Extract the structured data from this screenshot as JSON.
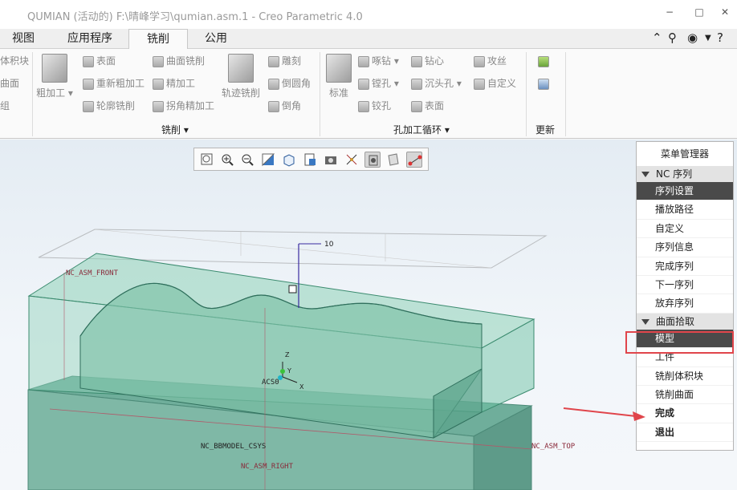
{
  "window": {
    "title": "QUMIAN (活动的) F:\\晴峰学习\\qumian.asm.1 - Creo Parametric 4.0",
    "minimize": "−",
    "maximize": "□",
    "close": "✕"
  },
  "tabs": [
    {
      "label": "视图"
    },
    {
      "label": "应用程序"
    },
    {
      "label": "铣削"
    },
    {
      "label": "公用"
    }
  ],
  "ribbon": {
    "partial_items": [
      "体积块",
      "曲面",
      "组"
    ],
    "milling": {
      "group_label": "铣削 ▾",
      "rough_label": "粗加工 ▾",
      "col1": [
        "表面",
        "重新粗加工",
        "轮廓铣削"
      ],
      "col2": [
        "曲面铣削",
        "精加工",
        "拐角精加工"
      ],
      "trajectory_label": "轨迹铣削",
      "col3": [
        "雕刻",
        "倒圆角",
        "倒角"
      ]
    },
    "hole": {
      "group_label": "孔加工循环 ▾",
      "standard_label": "标准",
      "col1": [
        "啄钻 ▾",
        "镗孔 ▾",
        "铰孔"
      ],
      "col2": [
        "钻心",
        "沉头孔 ▾",
        "表面"
      ],
      "col3": [
        "攻丝",
        "自定义"
      ]
    },
    "update": {
      "group_label": "更新"
    }
  },
  "model_labels": {
    "front": "NC_ASM_FRONT",
    "top": "NC_ASM_TOP",
    "right": "NC_ASM_RIGHT",
    "csys": "NC_BBMODEL_CSYS",
    "acs": "ACS0",
    "value": "10",
    "x": "X",
    "y": "Y",
    "z": "Z"
  },
  "menu_manager": {
    "title": "菜单管理器",
    "sections": [
      {
        "label": "NC 序列",
        "items": [
          "序列设置",
          "播放路径",
          "自定义",
          "序列信息",
          "完成序列",
          "下一序列",
          "放弃序列"
        ],
        "selected_index": 0
      },
      {
        "label": "曲面拾取",
        "items": [
          "模型",
          "工件",
          "铣削体积块",
          "铣削曲面",
          "完成",
          "退出"
        ],
        "selected_index": 0
      }
    ]
  },
  "colors": {
    "model_fill": "#76c4a9",
    "highlight_red": "#e0454b",
    "selected_menu": "#4a4a4a"
  }
}
